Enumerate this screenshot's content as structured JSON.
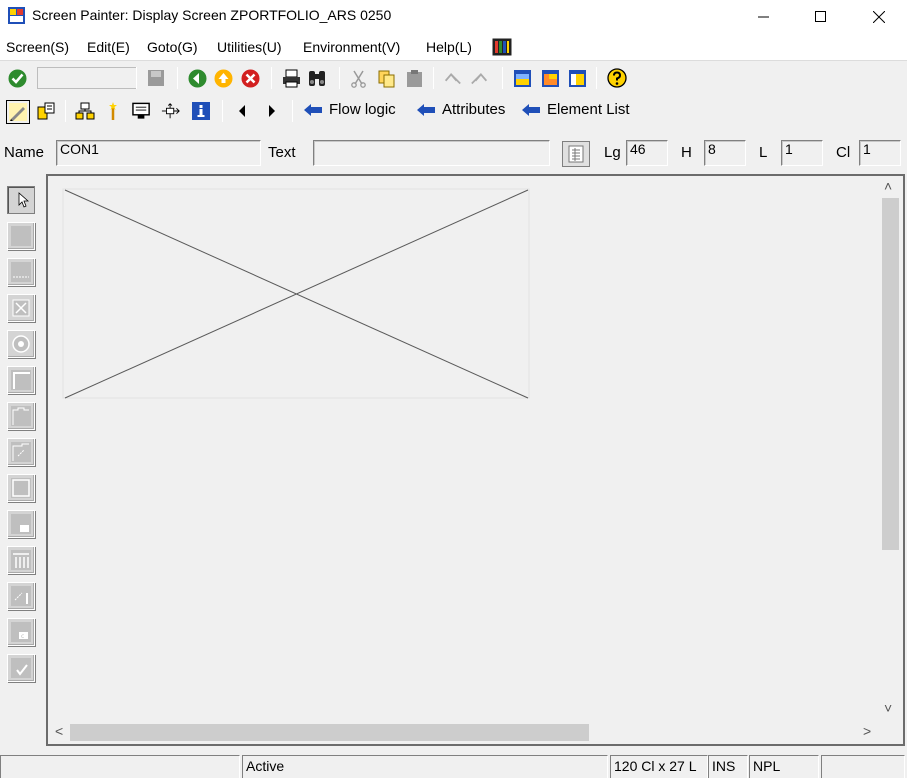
{
  "window": {
    "title": "Screen Painter:  Display Screen ZPORTFOLIO_ARS 0250",
    "minimize_symbol": "—",
    "maximize_symbol": "☐",
    "close_symbol": "✕"
  },
  "menu": {
    "items": [
      "Screen(S)",
      "Edit(E)",
      "Goto(G)",
      "Utilities(U)",
      "Environment(V)",
      "Help(L)"
    ]
  },
  "toolbar2": {
    "links": [
      "Flow logic",
      "Attributes",
      "Element List"
    ]
  },
  "element": {
    "name_label": "Name",
    "name_value": "CON1",
    "text_label": "Text",
    "text_value": "",
    "lg_label": "Lg",
    "lg_value": "46",
    "h_label": "H",
    "h_value": "8",
    "l_label": "L",
    "l_value": "1",
    "cl_label": "Cl",
    "cl_value": "1"
  },
  "palette": {
    "tools": [
      "pointer-icon",
      "text-field-icon",
      "input-field-icon",
      "checkbox-icon",
      "radio-button-icon",
      "frame-icon",
      "tabstrip-icon",
      "tabstrip-wizard-icon",
      "subscreen-icon",
      "custom-control-icon",
      "table-control-icon",
      "table-wizard-icon",
      "status-icon-icon",
      "checkmark-icon"
    ]
  },
  "scroll": {
    "up": "˄",
    "down": "˅",
    "left": "<",
    "right": ">"
  },
  "status": {
    "system": "",
    "mode": "Active",
    "size": "120 Cl x 27 L",
    "ins": "INS",
    "npl": "NPL"
  },
  "colors": {
    "accent_blue": "#1f4fb8",
    "ok_green": "#2e8b2e",
    "stop_red": "#d22020",
    "help_yellow": "#ffd200"
  }
}
